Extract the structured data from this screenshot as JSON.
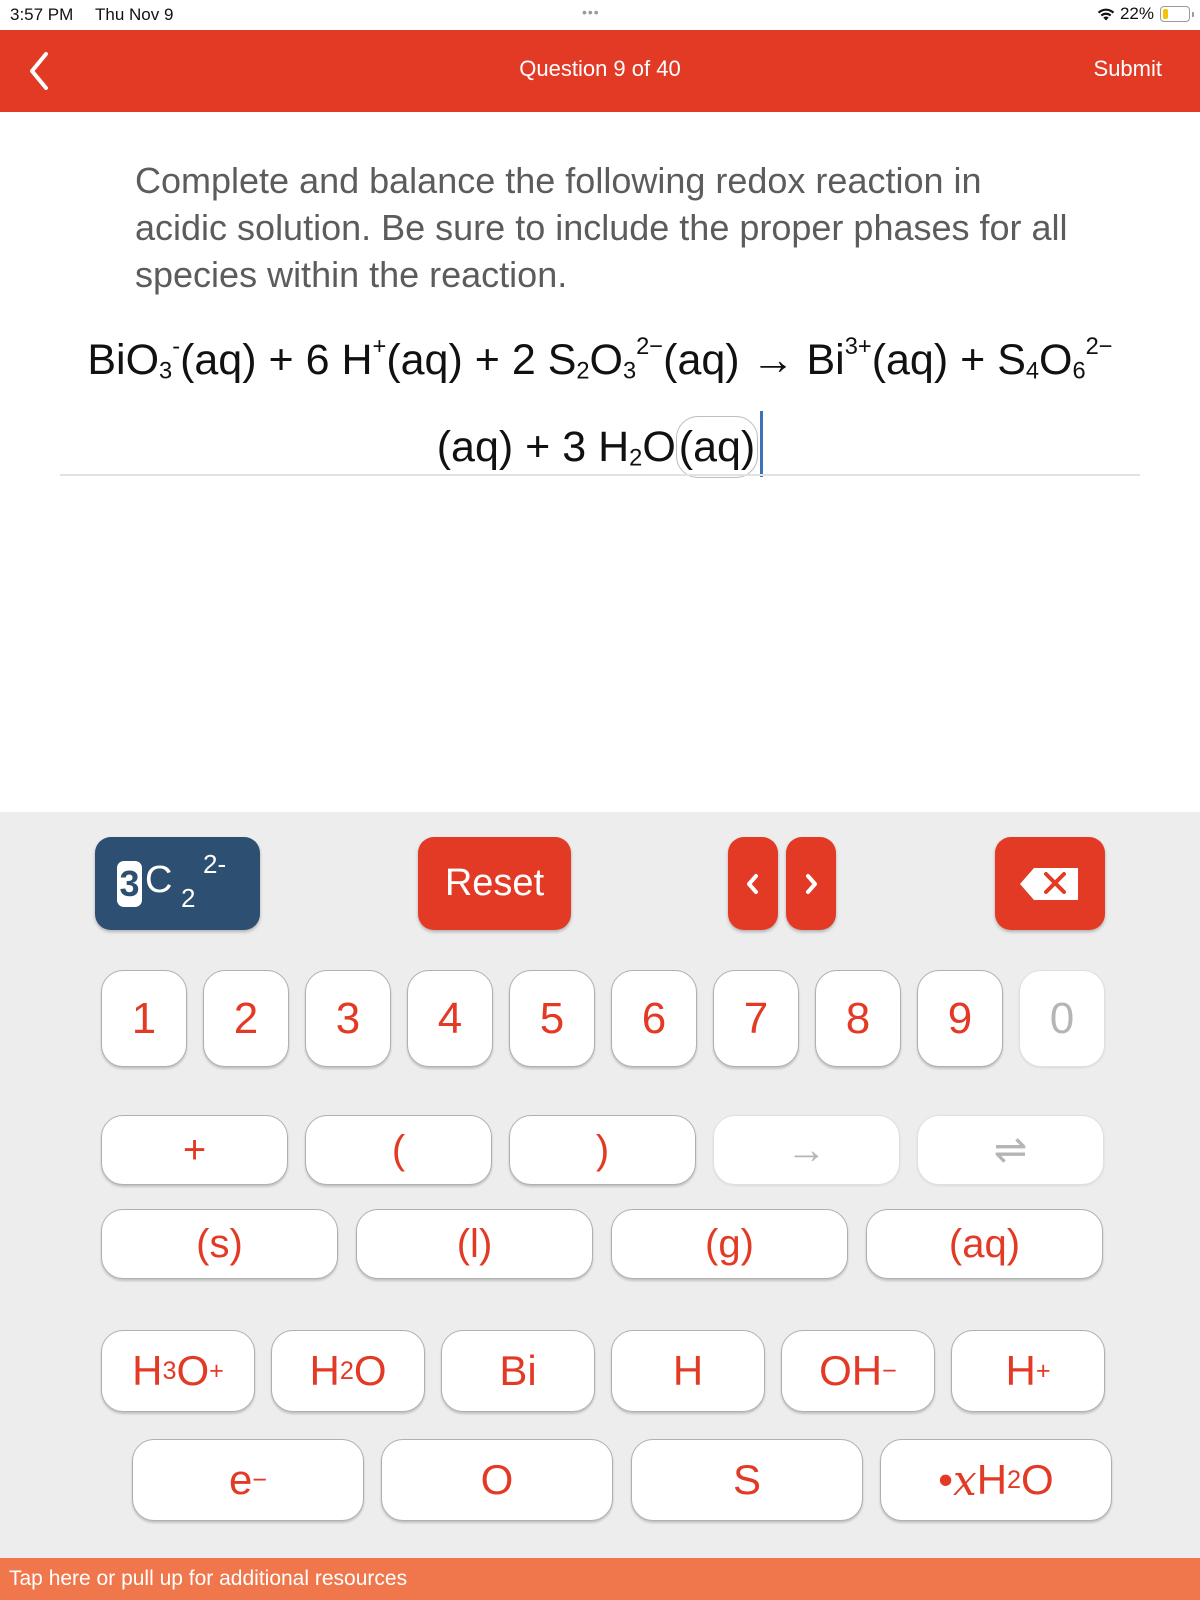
{
  "status_bar": {
    "time": "3:57 PM",
    "date": "Thu Nov 9",
    "dots": "•••",
    "battery_percent_label": "22%",
    "battery_level": 0.22,
    "icons": [
      "wifi-icon",
      "battery-icon"
    ]
  },
  "header": {
    "back_icon": "chevron-left-icon",
    "title": "Question 9 of 40",
    "submit_label": "Submit"
  },
  "question": {
    "prompt": "Complete and balance the following redox reaction in acidic solution. Be sure to include the proper phases for all species within the reaction."
  },
  "equation": {
    "text": "BiO3⁻(aq) + 6 H⁺(aq) + 2 S2O3²⁻(aq) → Bi³⁺(aq) + S4O6²⁻(aq) + 3 H2O(aq)",
    "terms": [
      {
        "coef": "",
        "base": "BiO",
        "sub": "3",
        "sup": "-",
        "phase": "(aq)"
      },
      {
        "op": "+"
      },
      {
        "coef": "6",
        "base": "H",
        "sub": "",
        "sup": "+",
        "phase": "(aq)"
      },
      {
        "op": "+"
      },
      {
        "coef": "2",
        "base": "S",
        "sub1": "2",
        "base2": "O",
        "sub": "3",
        "sup": "2−",
        "phase": "(aq)"
      },
      {
        "op": "→"
      },
      {
        "coef": "",
        "base": "Bi",
        "sub": "",
        "sup": "3+",
        "phase": "(aq)"
      },
      {
        "op": "+"
      },
      {
        "coef": "",
        "base": "S",
        "sub1": "4",
        "base2": "O",
        "sub": "6",
        "sup": "2−",
        "phase": "(aq)"
      },
      {
        "op": "+"
      },
      {
        "coef": "3",
        "base": "H",
        "sub1": "2",
        "base2": "O",
        "sub": "",
        "sup": "",
        "phase": "(aq)",
        "selected": true
      }
    ]
  },
  "keyboard": {
    "charge_button": {
      "coefficient": "3",
      "element": "C",
      "subscript": "2",
      "superscript": "2-"
    },
    "reset_label": "Reset",
    "nav_left_icon": "chevron-left-icon",
    "nav_right_icon": "chevron-right-icon",
    "delete_icon": "backspace-icon",
    "numbers": [
      {
        "label": "1",
        "enabled": true
      },
      {
        "label": "2",
        "enabled": true
      },
      {
        "label": "3",
        "enabled": true
      },
      {
        "label": "4",
        "enabled": true
      },
      {
        "label": "5",
        "enabled": true
      },
      {
        "label": "6",
        "enabled": true
      },
      {
        "label": "7",
        "enabled": true
      },
      {
        "label": "8",
        "enabled": true
      },
      {
        "label": "9",
        "enabled": true
      },
      {
        "label": "0",
        "enabled": false
      }
    ],
    "symbols": [
      {
        "label": "+",
        "enabled": true
      },
      {
        "label": "(",
        "enabled": true
      },
      {
        "label": ")",
        "enabled": true
      },
      {
        "label": "→",
        "enabled": false
      },
      {
        "label": "⇌",
        "enabled": false
      }
    ],
    "phases": [
      "(s)",
      "(l)",
      "(g)",
      "(aq)"
    ],
    "species_row1": [
      {
        "base": "H",
        "sub": "3",
        "base2": "O",
        "sup": "+"
      },
      {
        "base": "H",
        "sub": "2",
        "base2": "O",
        "sup": ""
      },
      {
        "base": "Bi",
        "sub": "",
        "base2": "",
        "sup": ""
      },
      {
        "base": "H",
        "sub": "",
        "base2": "",
        "sup": ""
      },
      {
        "base": "OH",
        "sub": "",
        "base2": "",
        "sup": "−"
      },
      {
        "base": "H",
        "sub": "",
        "base2": "",
        "sup": "+"
      }
    ],
    "species_row2": [
      {
        "base": "e",
        "sup": "−"
      },
      {
        "base": "O"
      },
      {
        "base": "S"
      },
      {
        "prefix": "• ",
        "italic": "x",
        "base": " H",
        "sub": "2",
        "base2": "O"
      }
    ]
  },
  "footer": {
    "label": "Tap here or pull up for additional resources"
  }
}
